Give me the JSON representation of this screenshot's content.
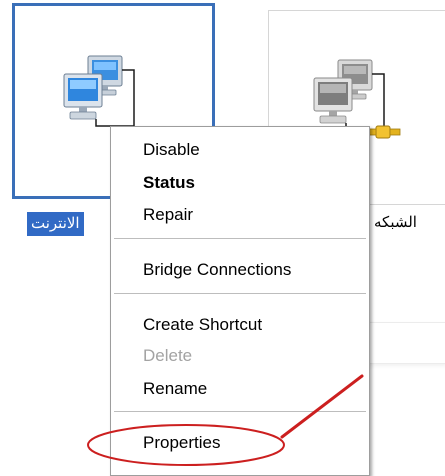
{
  "connections": [
    {
      "label": "الانترنت",
      "selected": true,
      "icon": "network-connection-icon"
    },
    {
      "label": "الشبكه",
      "selected": false,
      "icon": "lan-connection-icon"
    }
  ],
  "context_menu": {
    "items": [
      {
        "label": "Disable",
        "style": "normal"
      },
      {
        "label": "Status",
        "style": "bold"
      },
      {
        "label": "Repair",
        "style": "normal"
      },
      {
        "label": "Bridge Connections",
        "style": "normal"
      },
      {
        "label": "Create Shortcut",
        "style": "normal"
      },
      {
        "label": "Delete",
        "style": "disabled"
      },
      {
        "label": "Rename",
        "style": "normal"
      },
      {
        "label": "Properties",
        "style": "normal"
      }
    ]
  },
  "annotation": {
    "color": "#cc1f1f",
    "type": "ellipse-with-arrow",
    "target": "Properties"
  },
  "colors": {
    "selection": "#316ac5",
    "tile_border": "#3a6fb8"
  }
}
